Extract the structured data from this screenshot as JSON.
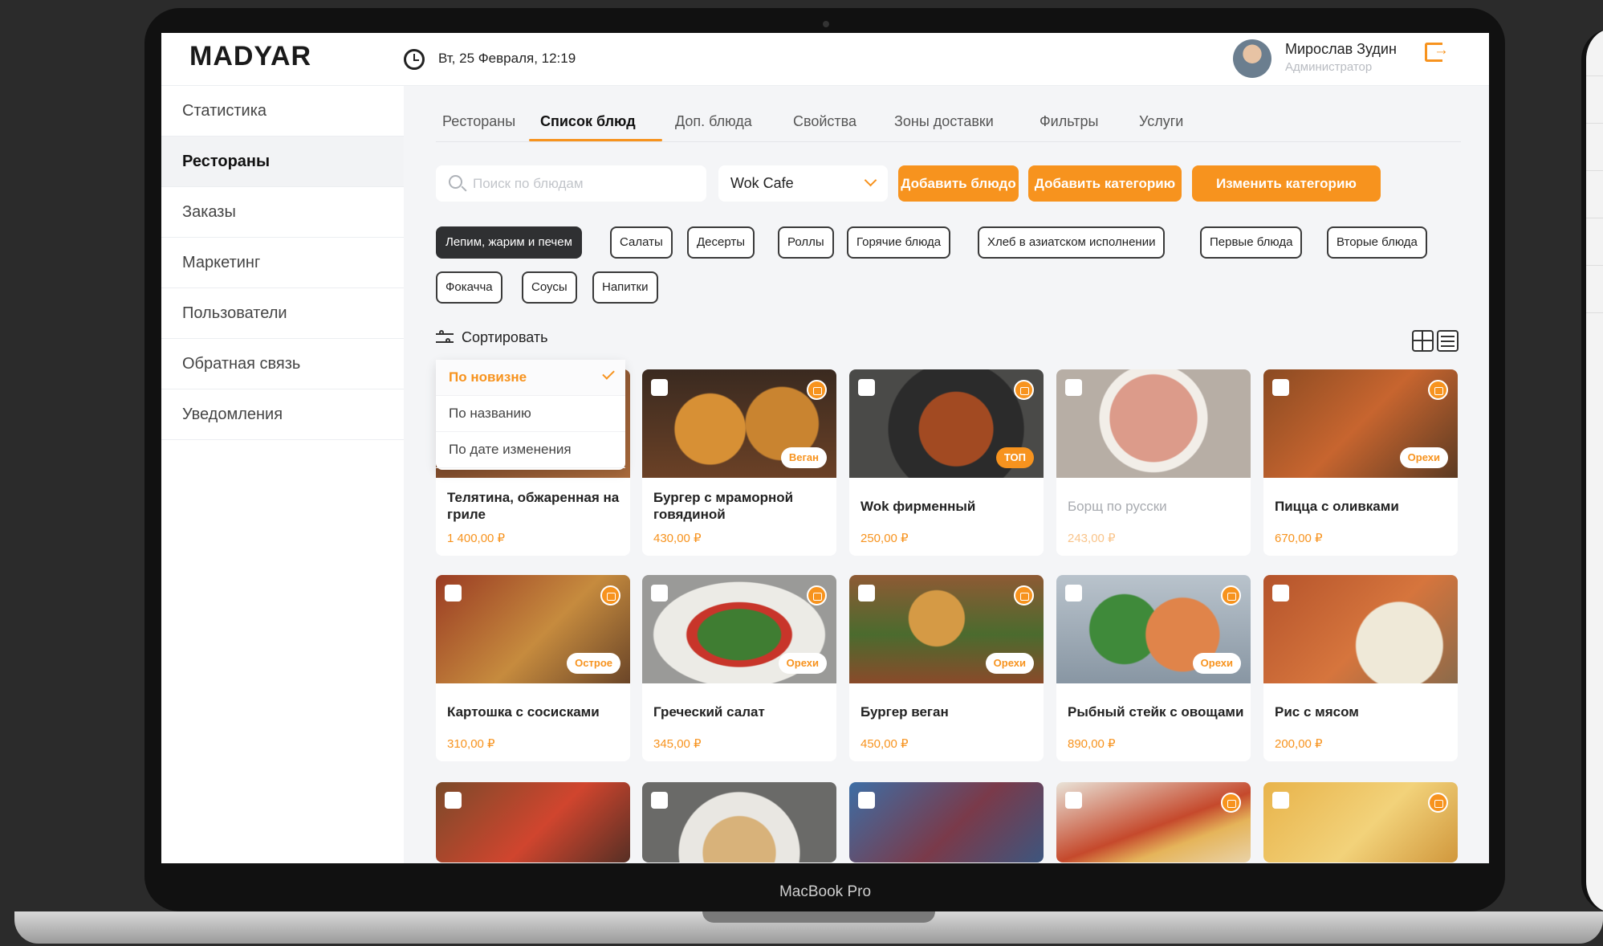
{
  "app": {
    "logo": "MADYAR",
    "datetime": "Вт, 25 Февраля, 12:19",
    "device_label": "MacBook Pro"
  },
  "user": {
    "name": "Мирослав Зудин",
    "role": "Администратор"
  },
  "sidebar": {
    "items": [
      {
        "label": "Статистика"
      },
      {
        "label": "Рестораны"
      },
      {
        "label": "Заказы"
      },
      {
        "label": "Маркетинг"
      },
      {
        "label": "Пользователи"
      },
      {
        "label": "Обратная связь"
      },
      {
        "label": "Уведомления"
      }
    ]
  },
  "tabs": [
    {
      "label": "Рестораны"
    },
    {
      "label": "Список блюд"
    },
    {
      "label": "Доп. блюда"
    },
    {
      "label": "Свойства"
    },
    {
      "label": "Зоны доставки"
    },
    {
      "label": "Фильтры"
    },
    {
      "label": "Услуги"
    }
  ],
  "toolbar": {
    "search_placeholder": "Поиск по блюдам",
    "restaurant_selected": "Wok Cafe",
    "add_dish": "Добавить блюдо",
    "add_category": "Добавить категорию",
    "edit_category": "Изменить категорию"
  },
  "categories": [
    "Лепим, жарим и печем",
    "Салаты",
    "Десерты",
    "Роллы",
    "Горячие блюда",
    "Хлеб в азиатском исполнении",
    "Первые блюда",
    "Вторые блюда",
    "Фокачча",
    "Соусы",
    "Напитки"
  ],
  "sort": {
    "label": "Сортировать",
    "options": [
      "По новизне",
      "По названию",
      "По дате изменения"
    ],
    "selected": "По новизне"
  },
  "dishes": [
    {
      "name": "Телятина, обжаренная на гриле",
      "price": "1 400,00 ₽",
      "tag": ""
    },
    {
      "name": "Бургер с мраморной говядиной",
      "price": "430,00 ₽",
      "tag": "Веган"
    },
    {
      "name": "Wok фирменный",
      "price": "250,00 ₽",
      "tag": "ТОП"
    },
    {
      "name": "Борщ по русски",
      "price": "243,00 ₽",
      "tag": ""
    },
    {
      "name": "Пицца с оливками",
      "price": "670,00 ₽",
      "tag": "Орехи"
    },
    {
      "name": "Картошка с сосисками",
      "price": "310,00 ₽",
      "tag": "Острое"
    },
    {
      "name": "Греческий салат",
      "price": "345,00 ₽",
      "tag": "Орехи"
    },
    {
      "name": "Бургер веган",
      "price": "450,00 ₽",
      "tag": "Орехи"
    },
    {
      "name": "Рыбный стейк с овощами",
      "price": "890,00 ₽",
      "tag": "Орехи"
    },
    {
      "name": "Рис с мясом",
      "price": "200,00 ₽",
      "tag": ""
    }
  ],
  "colors": {
    "accent": "#f7931e",
    "chip_active": "#2f3032"
  }
}
